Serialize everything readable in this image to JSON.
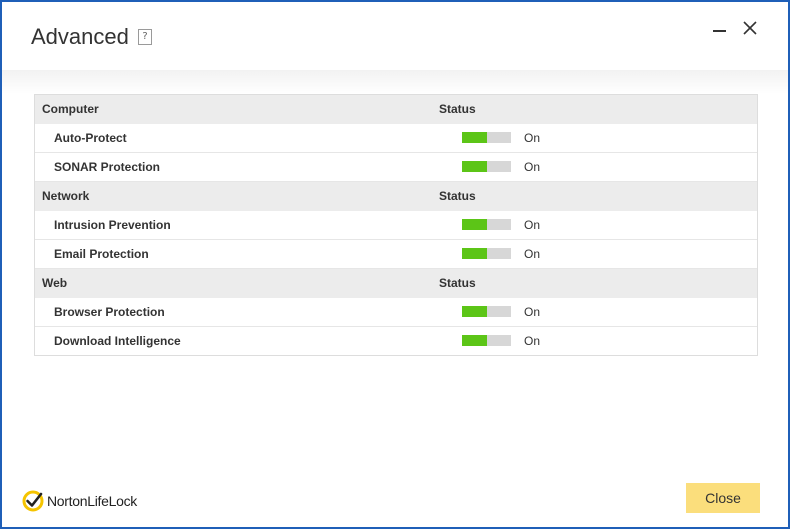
{
  "window": {
    "title": "Advanced",
    "help_glyph": "?"
  },
  "colors": {
    "toggle_on": "#5cc517",
    "toggle_track": "#d7d7d7",
    "close_button": "#fbde7c",
    "window_border": "#1f5fb8"
  },
  "sections": [
    {
      "name": "Computer",
      "status_header": "Status",
      "items": [
        {
          "label": "Auto-Protect",
          "status": "On",
          "level": 0.5
        },
        {
          "label": "SONAR Protection",
          "status": "On",
          "level": 0.5
        }
      ]
    },
    {
      "name": "Network",
      "status_header": "Status",
      "items": [
        {
          "label": "Intrusion Prevention",
          "status": "On",
          "level": 0.5
        },
        {
          "label": "Email Protection",
          "status": "On",
          "level": 0.5
        }
      ]
    },
    {
      "name": "Web",
      "status_header": "Status",
      "items": [
        {
          "label": "Browser Protection",
          "status": "On",
          "level": 0.5
        },
        {
          "label": "Download Intelligence",
          "status": "On",
          "level": 0.5
        }
      ]
    }
  ],
  "footer": {
    "brand": "NortonLifeLock",
    "close_label": "Close"
  },
  "icons": {
    "help": "help-icon",
    "minimize": "minimize-icon",
    "close": "close-icon",
    "logo": "norton-check-icon"
  }
}
